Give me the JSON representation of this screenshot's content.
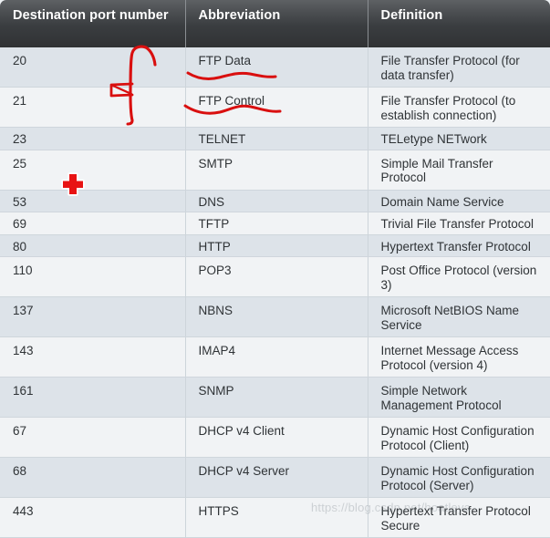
{
  "table": {
    "columns": [
      {
        "id": "destination_port_number",
        "label": "Destination port number"
      },
      {
        "id": "abbreviation",
        "label": "Abbreviation"
      },
      {
        "id": "definition",
        "label": "Definition"
      }
    ],
    "rows": [
      {
        "port": "20",
        "abbr": "FTP Data",
        "definition": "File Transfer Protocol (for data transfer)"
      },
      {
        "port": "21",
        "abbr": "FTP Control",
        "definition": "File Transfer Protocol (to establish connection)"
      },
      {
        "port": "23",
        "abbr": "TELNET",
        "definition": "TELetype NETwork"
      },
      {
        "port": "25",
        "abbr": "SMTP",
        "definition": "Simple Mail Transfer Protocol"
      },
      {
        "port": "53",
        "abbr": "DNS",
        "definition": "Domain Name Service"
      },
      {
        "port": "69",
        "abbr": "TFTP",
        "definition": "Trivial File Transfer Protocol"
      },
      {
        "port": "80",
        "abbr": "HTTP",
        "definition": "Hypertext Transfer Protocol"
      },
      {
        "port": "110",
        "abbr": "POP3",
        "definition": "Post Office Protocol (version 3)"
      },
      {
        "port": "137",
        "abbr": "NBNS",
        "definition": "Microsoft NetBIOS Name Service"
      },
      {
        "port": "143",
        "abbr": "IMAP4",
        "definition": "Internet Message Access Protocol (version 4)"
      },
      {
        "port": "161",
        "abbr": "SNMP",
        "definition": "Simple Network Management Protocol"
      },
      {
        "port": "67",
        "abbr": "DHCP v4 Client",
        "definition": "Dynamic Host Configuration Protocol (Client)"
      },
      {
        "port": "68",
        "abbr": "DHCP v4 Server",
        "definition": "Dynamic Host Configuration Protocol (Server)"
      },
      {
        "port": "443",
        "abbr": "HTTPS",
        "definition": "Hypertext Transfer Protocol Secure"
      }
    ]
  },
  "annotations": {
    "ink_color": "#d90f0f",
    "cursor_icon": "red-cross-cursor",
    "marks": [
      {
        "name": "vertical-bracket",
        "target_rows": [
          "20",
          "21"
        ]
      },
      {
        "name": "wavy-underline-ftp-data",
        "target": "FTP Data"
      },
      {
        "name": "wavy-underline-ftp-control",
        "target": "FTP Control"
      }
    ]
  },
  "watermark": {
    "text": "https://blog.csdn.net/hoatleya"
  },
  "colors": {
    "header_top": "#5e6164",
    "header_bottom": "#303234",
    "row_alt": "#dde3e9",
    "row_norm": "#f1f3f5",
    "text": "#2f3336",
    "ink": "#d90f0f"
  }
}
